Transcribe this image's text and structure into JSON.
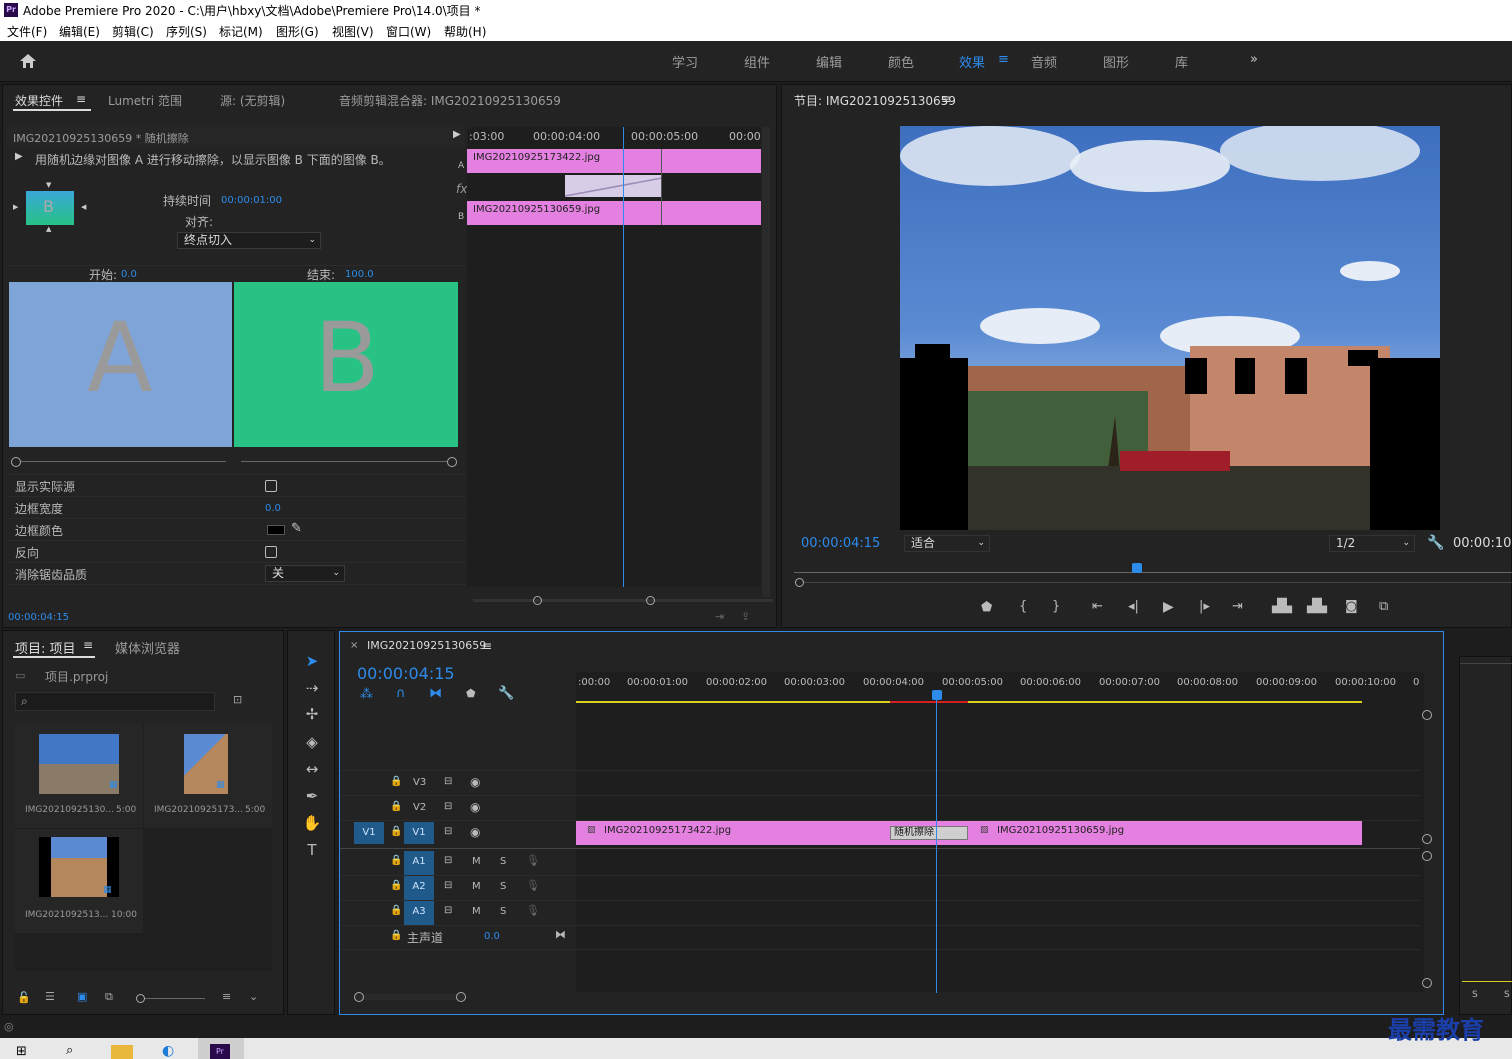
{
  "window": {
    "title": "Adobe Premiere Pro 2020 - C:\\用户\\hbxy\\文档\\Adobe\\Premiere Pro\\14.0\\项目 *",
    "app_badge": "Pr"
  },
  "menu": [
    "文件(F)",
    "编辑(E)",
    "剪辑(C)",
    "序列(S)",
    "标记(M)",
    "图形(G)",
    "视图(V)",
    "窗口(W)",
    "帮助(H)"
  ],
  "workspaces": [
    "学习",
    "组件",
    "编辑",
    "颜色",
    "效果",
    "音频",
    "图形",
    "库"
  ],
  "workspace_active": "效果",
  "effect_controls": {
    "tabs": [
      "效果控件",
      "Lumetri 范围",
      "源: (无剪辑)",
      "音频剪辑混合器: IMG20210925130659"
    ],
    "clip_header": "IMG20210925130659 * 随机擦除",
    "description": "用随机边缘对图像 A 进行移动擦除，以显示图像 B 下面的图像 B。",
    "duration_label": "持续时间",
    "duration_value": "00:00:01:00",
    "align_label": "对齐:",
    "align_value": "终点切入",
    "start_label": "开始:",
    "start_value": "0.0",
    "end_label": "结束:",
    "end_value": "100.0",
    "preview_a": "A",
    "preview_b": "B",
    "preview_letter": "B",
    "props": {
      "show_source": "显示实际源",
      "border_width": "边框宽度",
      "border_width_value": "0.0",
      "border_color": "边框颜色",
      "reverse": "反向",
      "antialias": "消除锯齿品质",
      "antialias_value": "关"
    },
    "timecode": "00:00:04:15",
    "mini_timeline": {
      "ruler": [
        ":03:00",
        "00:00:04:00",
        "00:00:05:00",
        "00:00"
      ],
      "clip_a": "IMG20210925173422.jpg",
      "clip_b": "IMG20210925130659.jpg",
      "label_a": "A",
      "label_b": "B",
      "fx": "fx"
    }
  },
  "program": {
    "title": "节目: IMG20210925130659",
    "timecode": "00:00:04:15",
    "fit": "适合",
    "resolution": "1/2",
    "end_time": "00:00:10:"
  },
  "project": {
    "tabs": [
      "项目: 项目",
      "媒体浏览器"
    ],
    "file": "项目.prproj",
    "items": [
      {
        "name": "IMG20210925130...",
        "dur": "5:00"
      },
      {
        "name": "IMG20210925173...",
        "dur": "5:00"
      },
      {
        "name": "IMG2021092513...",
        "dur": "10:00"
      }
    ]
  },
  "timeline": {
    "title": "IMG20210925130659",
    "timecode": "00:00:04:15",
    "ruler": [
      ":00:00",
      "00:00:01:00",
      "00:00:02:00",
      "00:00:03:00",
      "00:00:04:00",
      "00:00:05:00",
      "00:00:06:00",
      "00:00:07:00",
      "00:00:08:00",
      "00:00:09:00",
      "00:00:10:00",
      "0"
    ],
    "tracks_video": [
      "V3",
      "V2",
      "V1"
    ],
    "tracks_audio": [
      "A1",
      "A2",
      "A3"
    ],
    "source_patch": "V1",
    "master": "主声道",
    "master_value": "0.0",
    "mute": "M",
    "solo": "S",
    "clip1": "IMG20210925173422.jpg",
    "transition": "随机擦除",
    "clip2": "IMG20210925130659.jpg"
  },
  "audio_meter": {
    "left": "S",
    "right": "S"
  },
  "watermark": "最需教育",
  "colors": {
    "accent": "#2d8ceb",
    "clip": "#e480e0",
    "panel": "#232323",
    "a_preview": "#7fa4d8",
    "b_preview": "#28c285"
  }
}
